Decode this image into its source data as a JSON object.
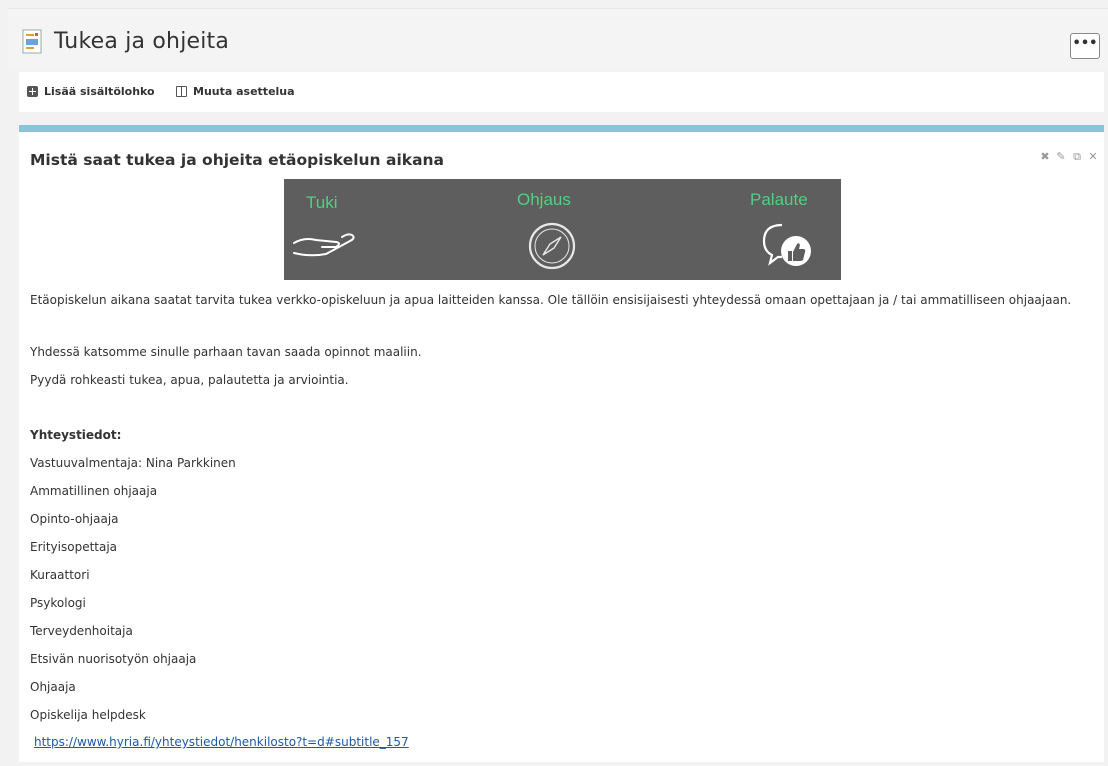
{
  "header": {
    "title": "Tukea ja ohjeita",
    "more_label": "•••"
  },
  "toolbar": {
    "add_block_label": "Lisää sisältölohko",
    "change_layout_label": "Muuta asettelua"
  },
  "block": {
    "title": "Mistä saat tukea ja ohjeita etäopiskelun aikana",
    "controls": [
      "move-icon",
      "edit-icon",
      "copy-icon",
      "close-icon"
    ],
    "banner": {
      "labels": [
        "Tuki",
        "Ohjaus",
        "Palaute"
      ],
      "icons": [
        "hand-icon",
        "compass-icon",
        "feedback-thumbs-up-icon"
      ],
      "text_color": "#4fd182",
      "background": "#5e5e5e"
    },
    "paragraphs": [
      "Etäopiskelun aikana saatat tarvita tukea verkko-opiskeluun ja apua laitteiden kanssa. Ole tällöin ensisijaisesti yhteydessä omaan opettajaan ja / tai ammatilliseen ohjaajaan.",
      "Yhdessä katsomme sinulle parhaan tavan saada opinnot maaliin.",
      "Pyydä rohkeasti tukea, apua, palautetta ja arviointia."
    ],
    "contacts_heading": "Yhteystiedot:",
    "contacts": [
      "Vastuuvalmentaja: Nina Parkkinen",
      "Ammatillinen ohjaaja",
      "Opinto-ohjaaja",
      "Erityisopettaja",
      "Kuraattori",
      "Psykologi",
      "Terveydenhoitaja",
      "Etsivän nuorisotyön ohjaaja",
      "Ohjaaja",
      "Opiskelija helpdesk"
    ],
    "link": "https://www.hyria.fi/yhteystiedot/henkilosto?t=d#subtitle_157"
  },
  "colors": {
    "accent_bar": "#89c4d8",
    "link": "#1a5aa8"
  }
}
